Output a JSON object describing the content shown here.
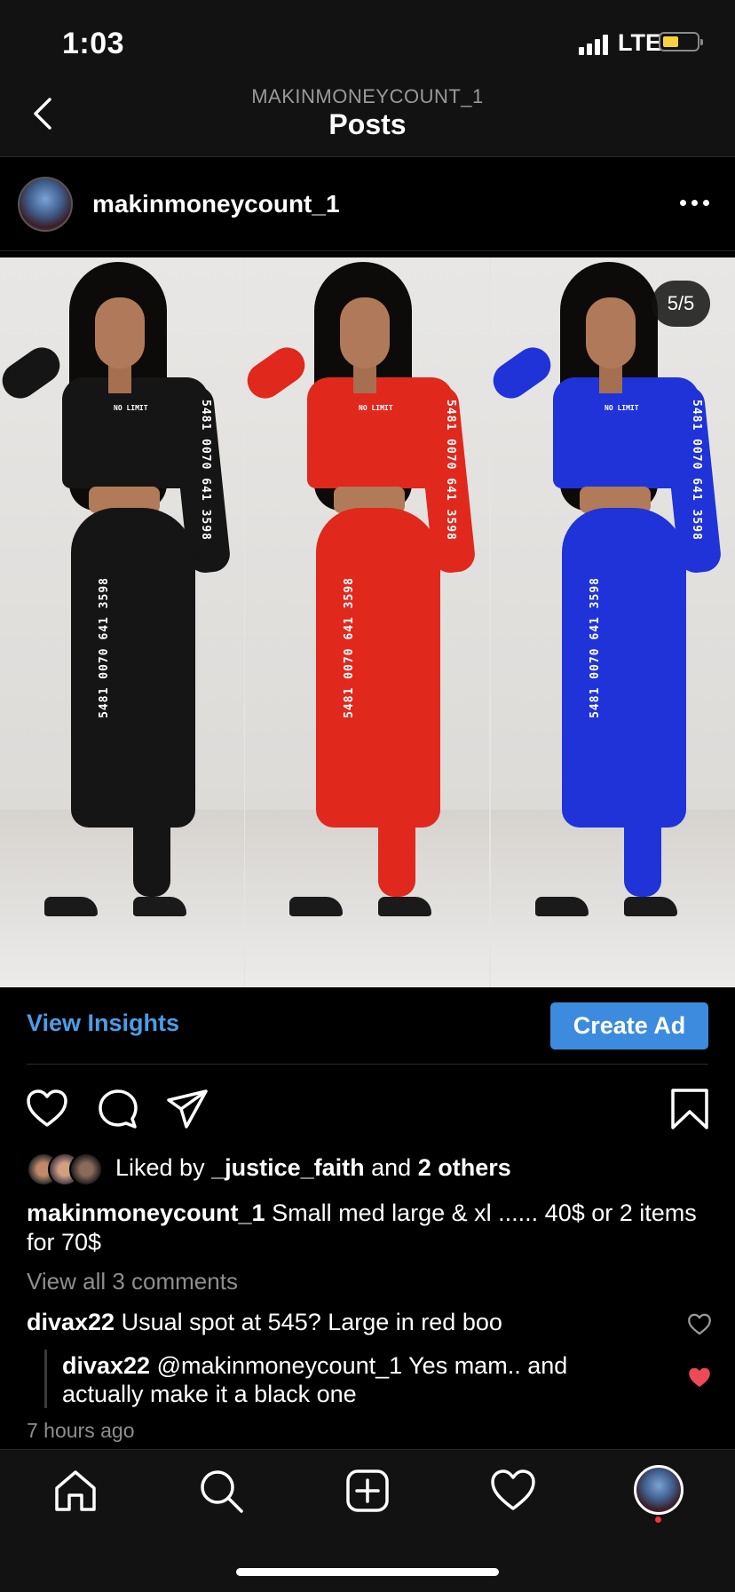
{
  "status": {
    "time": "1:03",
    "network": "LTE"
  },
  "header": {
    "subtitle": "MAKINMONEYCOUNT_1",
    "title": "Posts"
  },
  "post": {
    "username": "makinmoneycount_1",
    "counter": "5/5",
    "image_panels": [
      {
        "color": "#151515",
        "chest_text": "NO LIMIT",
        "sleeve_text": "5481 0070 641 3598",
        "leg_text": "5481 0070 641 3598"
      },
      {
        "color": "#e0281d",
        "chest_text": "NO LIMIT",
        "sleeve_text": "5481 0070 641 3598",
        "leg_text": "5481 0070 641 3598"
      },
      {
        "color": "#1f33d8",
        "chest_text": "NO LIMIT",
        "sleeve_text": "5481 0070 641 3598",
        "leg_text": "5481 0070 641 3598"
      }
    ],
    "view_insights": "View Insights",
    "create_ad": "Create Ad",
    "likes": {
      "prefix": "Liked by ",
      "user": "_justice_faith",
      "middle": " and ",
      "others": "2 others"
    },
    "caption": {
      "user": "makinmoneycount_1",
      "text": " Small med large & xl ...... 40$ or 2 items for 70$"
    },
    "view_comments": "View all 3 comments",
    "comments": [
      {
        "user": "divax22",
        "text": " Usual spot at 545? Large in red boo"
      },
      {
        "user": "divax22",
        "text": " @makinmoneycount_1 Yes mam.. and actually make it a black one"
      }
    ],
    "time_ago": "7 hours ago"
  },
  "colors": {
    "accent_link": "#4a9ee8",
    "button": "#3d8bde",
    "liked_heart": "#ed4956"
  },
  "icons": [
    "back-chevron-icon",
    "more-icon",
    "heart-icon",
    "comment-icon",
    "share-icon",
    "bookmark-icon",
    "home-icon",
    "search-icon",
    "add-post-icon",
    "activity-icon",
    "profile-icon"
  ]
}
